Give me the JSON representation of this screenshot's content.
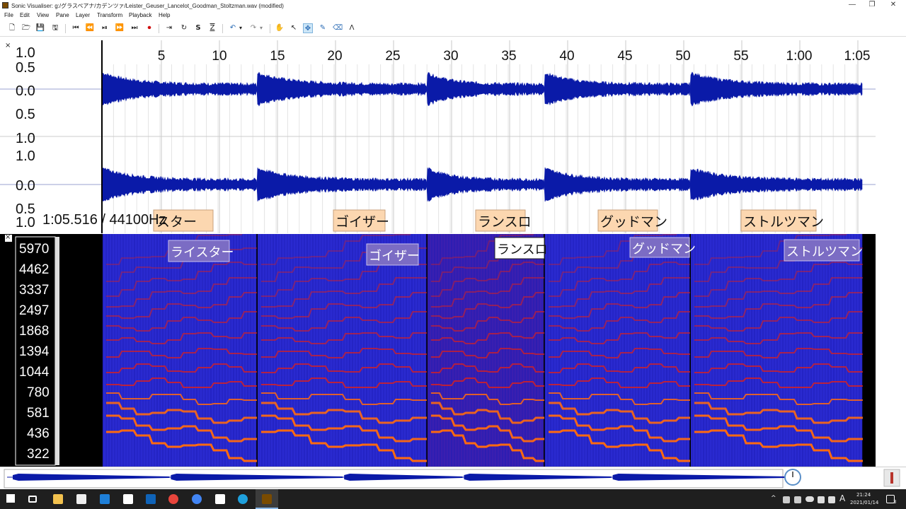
{
  "window": {
    "title": "Sonic Visualiser: g:/グラスペアナ/カデンツァ/Leister_Geuser_Lancelot_Goodman_Stoltzman.wav (modified)",
    "min_glyph": "—",
    "max_glyph": "❐",
    "close_glyph": "✕"
  },
  "menu": [
    "File",
    "Edit",
    "View",
    "Pane",
    "Layer",
    "Transform",
    "Playback",
    "Help"
  ],
  "toolbar": {
    "new": "🗋",
    "open": "🗁",
    "save": "💾",
    "save_as": "🖫",
    "rewind_start": "⏮",
    "rewind": "⏪",
    "play_pause": "⏯",
    "ffwd": "⏩",
    "ffwd_end": "⏭",
    "record": "⏺",
    "play_selection": "⇥",
    "loop": "↻",
    "solo": "S",
    "align": "Z",
    "undo": "↶",
    "undo_menu": "▾",
    "redo": "↷",
    "redo_menu": "▾",
    "navigate": "✋",
    "select": "↖",
    "edit": "✥",
    "draw": "✎",
    "erase": "⌫",
    "measure": "Λ"
  },
  "time_ruler": {
    "ticks": [
      "5",
      "10",
      "15",
      "20",
      "25",
      "30",
      "35",
      "40",
      "45",
      "50",
      "55",
      "1:00",
      "1:05"
    ]
  },
  "waveform_scale": [
    "1.0",
    "0.5",
    "0.0",
    "0.5",
    "1.0",
    "0.0",
    "0.5",
    "1.0"
  ],
  "status_readout": "1:05.516 / 44100Hz",
  "waveform_labels": [
    "ライスター",
    "ゴイザー",
    "ランスロ",
    "グッドマン",
    "ストルツマン"
  ],
  "waveform_label_visible": [
    "スター",
    "ゴイザー",
    "ランスロ",
    "グッドマン",
    "ストルツマン"
  ],
  "spectrogram_labels": [
    "ライスター",
    "ゴイザー",
    "ランスロ",
    "グッドマン",
    "ストルツマン"
  ],
  "frequency_scale": [
    "5970",
    "4462",
    "3337",
    "2497",
    "1868",
    "1394",
    "1044",
    "780",
    "581",
    "436",
    "322"
  ],
  "pane_close": "×",
  "tray": {
    "time": "21:24",
    "date": "2021/01/14",
    "ime": "A",
    "notify": "3",
    "chevron": "^"
  },
  "colors": {
    "waveform": "#0a1aa8",
    "spectrogram_bg": "#2020c8",
    "spectrogram_hot": "#ff2a00",
    "label_bg_waveform": "#fcd7b0",
    "label_bg_spec": "#7b6cc4",
    "playhead": "#000000"
  }
}
